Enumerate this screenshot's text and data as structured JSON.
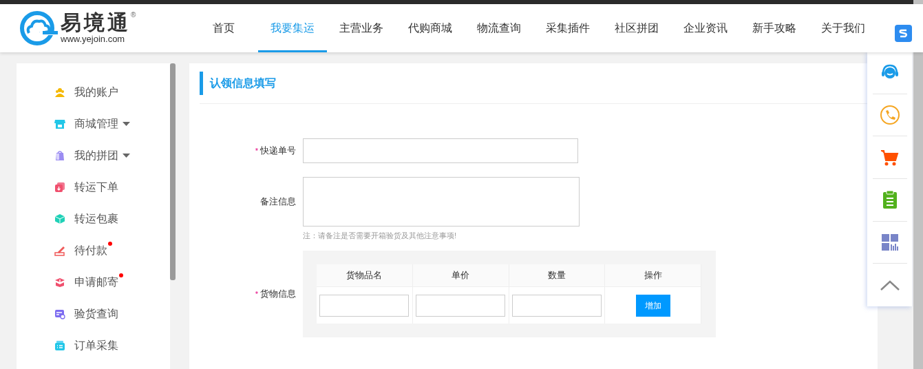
{
  "logo": {
    "name": "易境通",
    "registered": "®",
    "url": "www.yejoin.com"
  },
  "nav": [
    {
      "label": "首页",
      "selected": false
    },
    {
      "label": "我要集运",
      "selected": true
    },
    {
      "label": "主营业务",
      "selected": false
    },
    {
      "label": "代购商城",
      "selected": false
    },
    {
      "label": "物流查询",
      "selected": false
    },
    {
      "label": "采集插件",
      "selected": false
    },
    {
      "label": "社区拼团",
      "selected": false
    },
    {
      "label": "企业资讯",
      "selected": false
    },
    {
      "label": "新手攻略",
      "selected": false
    },
    {
      "label": "关于我们",
      "selected": false
    }
  ],
  "sidebar": {
    "items": [
      {
        "label": "我的账户",
        "dropdown": false,
        "badge": false
      },
      {
        "label": "商城管理",
        "dropdown": true,
        "badge": false
      },
      {
        "label": "我的拼团",
        "dropdown": true,
        "badge": false
      },
      {
        "label": "转运下单",
        "dropdown": false,
        "badge": false
      },
      {
        "label": "转运包裹",
        "dropdown": false,
        "badge": false
      },
      {
        "label": "待付款",
        "dropdown": false,
        "badge": true
      },
      {
        "label": "申请邮寄",
        "dropdown": false,
        "badge": true
      },
      {
        "label": "验货查询",
        "dropdown": false,
        "badge": false
      },
      {
        "label": "订单采集",
        "dropdown": false,
        "badge": false
      }
    ]
  },
  "form": {
    "title": "认领信息填写",
    "fields": [
      {
        "kind": "input",
        "label": "快递单号",
        "required": true,
        "required_mark": "*"
      },
      {
        "kind": "textarea",
        "label": "备注信息",
        "required": false,
        "note": "注：请备注是否需要开箱验货及其他注意事项!"
      }
    ],
    "goods": {
      "label": "货物信息",
      "required": true,
      "required_mark": "*",
      "columns": [
        "货物品名",
        "单价",
        "数量",
        "操作"
      ],
      "add_button": "增加"
    }
  }
}
